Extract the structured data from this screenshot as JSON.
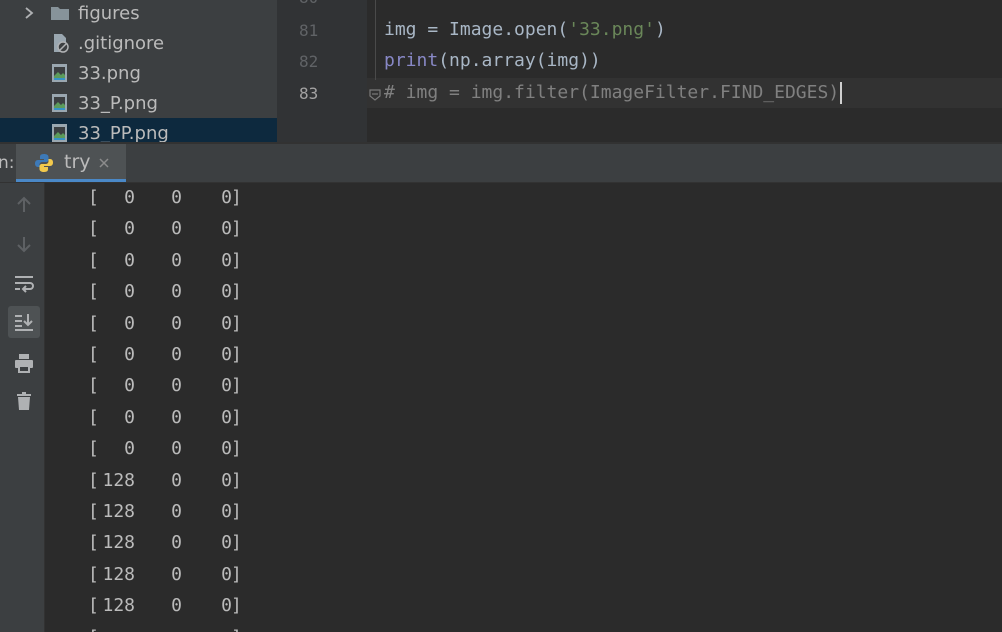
{
  "project_tree": {
    "items": [
      {
        "label": "figures",
        "icon": "folder-icon",
        "expandable": true
      },
      {
        "label": ".gitignore",
        "icon": "ignore-file-icon"
      },
      {
        "label": "33.png",
        "icon": "image-file-icon"
      },
      {
        "label": "33_P.png",
        "icon": "image-file-icon"
      },
      {
        "label": "33_PP.png",
        "icon": "image-file-icon",
        "selected": true
      }
    ]
  },
  "editor": {
    "partial_line_number": "80",
    "lines": [
      {
        "number": "81",
        "segments": [
          {
            "text": "img = Image.open(",
            "kind": "plain"
          },
          {
            "text": "'33.png'",
            "kind": "str"
          },
          {
            "text": ")",
            "kind": "plain"
          }
        ]
      },
      {
        "number": "82",
        "segments": [
          {
            "text": "print",
            "kind": "builtin"
          },
          {
            "text": "(np.array(img))",
            "kind": "plain"
          }
        ]
      },
      {
        "number": "83",
        "segments": [
          {
            "text": "# img = img.filter(ImageFilter.FIND_EDGES)",
            "kind": "comment"
          }
        ],
        "current": true
      }
    ]
  },
  "run_window": {
    "label": "n:",
    "tab": {
      "label": "try",
      "icon": "python-icon",
      "close_icon": "close-icon"
    },
    "toolbar": [
      {
        "name": "up-arrow-icon"
      },
      {
        "name": "down-arrow-icon"
      },
      {
        "name": "soft-wrap-icon"
      },
      {
        "name": "scroll-to-end-icon",
        "active": true
      },
      {
        "name": "print-icon"
      },
      {
        "name": "trash-icon"
      }
    ]
  },
  "console": {
    "rows": [
      [
        "0",
        "0",
        "0"
      ],
      [
        "0",
        "0",
        "0"
      ],
      [
        "0",
        "0",
        "0"
      ],
      [
        "0",
        "0",
        "0"
      ],
      [
        "0",
        "0",
        "0"
      ],
      [
        "0",
        "0",
        "0"
      ],
      [
        "0",
        "0",
        "0"
      ],
      [
        "0",
        "0",
        "0"
      ],
      [
        "0",
        "0",
        "0"
      ],
      [
        "128",
        "0",
        "0"
      ],
      [
        "128",
        "0",
        "0"
      ],
      [
        "128",
        "0",
        "0"
      ],
      [
        "128",
        "0",
        "0"
      ],
      [
        "128",
        "0",
        "0"
      ]
    ]
  },
  "colors": {
    "background": "#2b2b2b",
    "panel": "#3c3f41",
    "accent": "#4a88c7",
    "string": "#6a8759",
    "builtin": "#8888c6",
    "comment": "#808080"
  }
}
